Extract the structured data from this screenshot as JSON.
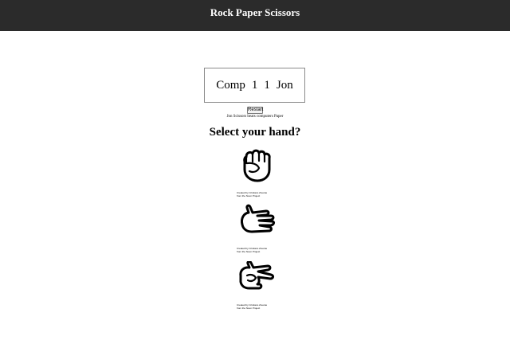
{
  "header": {
    "title": "Rock Paper Scissors"
  },
  "scoreboard": {
    "left_name": "Comp",
    "left_score": "1",
    "right_score": "1",
    "right_name": "Jon"
  },
  "controls": {
    "restart_label": "Restart"
  },
  "result_text": "Jon Scissors beats computers Paper",
  "prompt": "Select your hand?",
  "hands": [
    {
      "name": "rock",
      "credit_line1": "Created by Cristiano Zoucas",
      "credit_line2": "from the Noun Project"
    },
    {
      "name": "paper",
      "credit_line1": "Created by Cristiano Zoucas",
      "credit_line2": "from the Noun Project"
    },
    {
      "name": "scissors",
      "credit_line1": "Created by Cristiano Zoucas",
      "credit_line2": "from the Noun Project"
    }
  ],
  "colors": {
    "header_bg": "#2b2b2b",
    "header_text": "#ffffff",
    "border": "#8a8a8a"
  }
}
